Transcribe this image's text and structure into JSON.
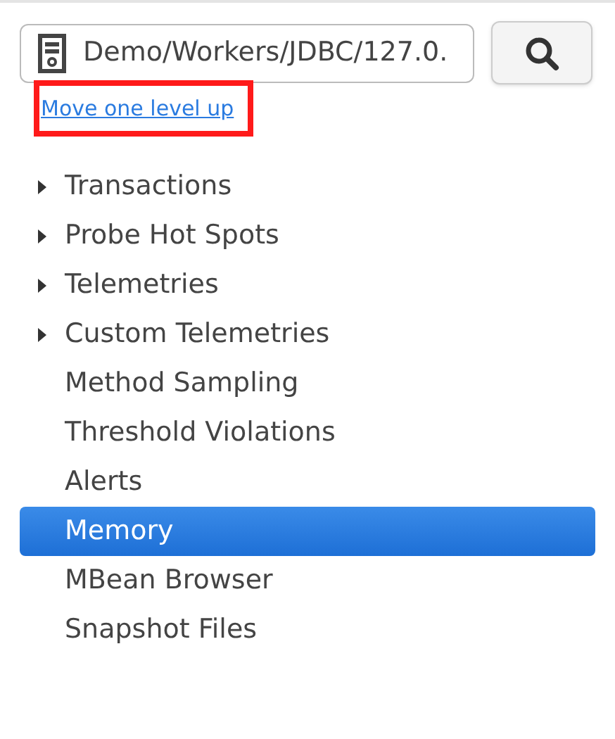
{
  "path_field": {
    "value": "Demo/Workers/JDBC/127.0."
  },
  "up_link": {
    "label": "Move one level up",
    "highlighted": true
  },
  "tree": [
    {
      "label": "Transactions",
      "kind": "folder",
      "selected": false
    },
    {
      "label": "Probe Hot Spots",
      "kind": "folder",
      "selected": false
    },
    {
      "label": "Telemetries",
      "kind": "folder",
      "selected": false
    },
    {
      "label": "Custom Telemetries",
      "kind": "folder",
      "selected": false
    },
    {
      "label": "Method Sampling",
      "kind": "leaf",
      "selected": false
    },
    {
      "label": "Threshold Violations",
      "kind": "leaf",
      "selected": false
    },
    {
      "label": "Alerts",
      "kind": "leaf",
      "selected": false
    },
    {
      "label": "Memory",
      "kind": "leaf",
      "selected": true
    },
    {
      "label": "MBean Browser",
      "kind": "leaf",
      "selected": false
    },
    {
      "label": "Snapshot Files",
      "kind": "leaf",
      "selected": false
    }
  ]
}
